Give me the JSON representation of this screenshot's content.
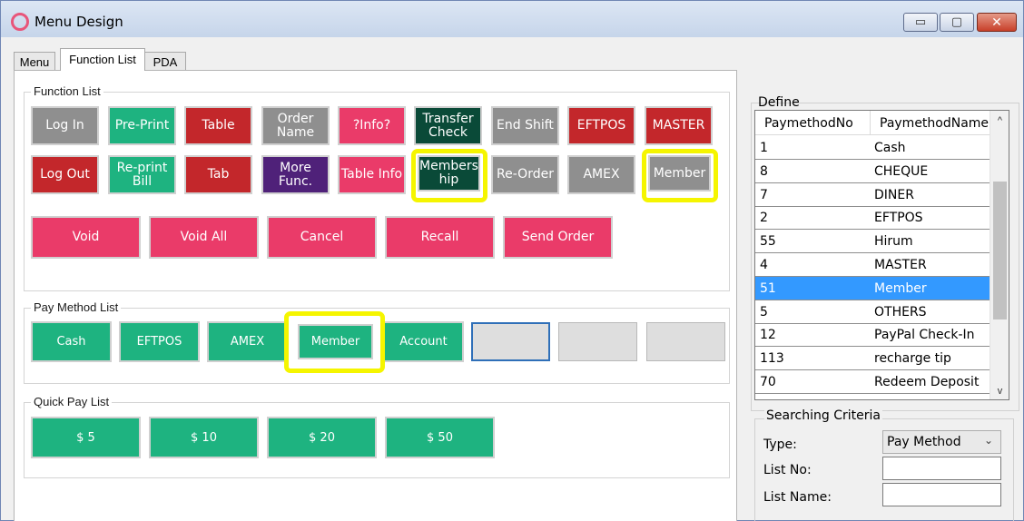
{
  "window": {
    "title": "Menu Design",
    "controls": {
      "minimize": "▭",
      "maximize": "▢",
      "close": "✕"
    }
  },
  "tabs": [
    {
      "label": "Menu"
    },
    {
      "label": "Function List"
    },
    {
      "label": "PDA"
    }
  ],
  "function_list": {
    "label": "Function List",
    "row1": [
      {
        "label": "Log In",
        "color": "gray"
      },
      {
        "label": "Pre-Print",
        "color": "green"
      },
      {
        "label": "Table",
        "color": "red"
      },
      {
        "label": "Order\nName",
        "color": "gray"
      },
      {
        "label": "?Info?",
        "color": "pink"
      },
      {
        "label": "Transfer\nCheck",
        "color": "darkgreen"
      },
      {
        "label": "End Shift",
        "color": "gray"
      },
      {
        "label": "EFTPOS",
        "color": "red"
      },
      {
        "label": "MASTER",
        "color": "red"
      }
    ],
    "row2": [
      {
        "label": "Log Out",
        "color": "red"
      },
      {
        "label": "Re-print\nBill",
        "color": "green"
      },
      {
        "label": "Tab",
        "color": "red"
      },
      {
        "label": "More\nFunc.",
        "color": "purple"
      },
      {
        "label": "Table Info",
        "color": "pink"
      },
      {
        "label": "Members\nhip",
        "color": "darkgreen"
      },
      {
        "label": "Re-Order",
        "color": "gray"
      },
      {
        "label": "AMEX",
        "color": "gray"
      },
      {
        "label": "Member",
        "color": "gray"
      }
    ],
    "row3": [
      {
        "label": "Void",
        "color": "pink"
      },
      {
        "label": "Void All",
        "color": "pink"
      },
      {
        "label": "Cancel",
        "color": "pink"
      },
      {
        "label": "Recall",
        "color": "pink"
      },
      {
        "label": "Send Order",
        "color": "pink"
      }
    ]
  },
  "pay_method_list": {
    "label": "Pay Method List",
    "buttons": [
      {
        "label": "Cash",
        "color": "green"
      },
      {
        "label": "EFTPOS",
        "color": "green"
      },
      {
        "label": "AMEX",
        "color": "green"
      },
      {
        "label": "Member",
        "color": "green"
      },
      {
        "label": "Account",
        "color": "green"
      },
      {
        "label": "",
        "color": "empty-focus"
      },
      {
        "label": "",
        "color": "empty"
      },
      {
        "label": "",
        "color": "empty"
      }
    ]
  },
  "quick_pay_list": {
    "label": "Quick Pay List",
    "buttons": [
      {
        "label": "$ 5"
      },
      {
        "label": "$ 10"
      },
      {
        "label": "$ 20"
      },
      {
        "label": "$ 50"
      }
    ]
  },
  "define": {
    "label": "Define",
    "columns": [
      "PaymethodNo",
      "PaymethodName"
    ],
    "rows": [
      {
        "no": "1",
        "name": "Cash"
      },
      {
        "no": "8",
        "name": "CHEQUE"
      },
      {
        "no": "7",
        "name": "DINER"
      },
      {
        "no": "2",
        "name": "EFTPOS"
      },
      {
        "no": "55",
        "name": "Hirum"
      },
      {
        "no": "4",
        "name": "MASTER"
      },
      {
        "no": "51",
        "name": "Member",
        "selected": true
      },
      {
        "no": "5",
        "name": "OTHERS"
      },
      {
        "no": "12",
        "name": "PayPal Check-In"
      },
      {
        "no": "113",
        "name": "recharge tip"
      },
      {
        "no": "70",
        "name": "Redeem Deposit"
      }
    ],
    "scroll": {
      "up": "^",
      "down": "v"
    }
  },
  "searching_criteria": {
    "label": "Searching Criteria",
    "type_label": "Type:",
    "type_value": "Pay Method",
    "list_no_label": "List No:",
    "list_no_value": "",
    "list_name_label": "List Name:",
    "list_name_value": ""
  },
  "colors": {
    "gray": "#8f8f8f",
    "green": "#1eb380",
    "red": "#c3272b",
    "pink": "#ea3b69",
    "darkgreen": "#0a4a38",
    "purple": "#4f2179",
    "highlight": "#f5f500",
    "selection": "#3399ff"
  }
}
